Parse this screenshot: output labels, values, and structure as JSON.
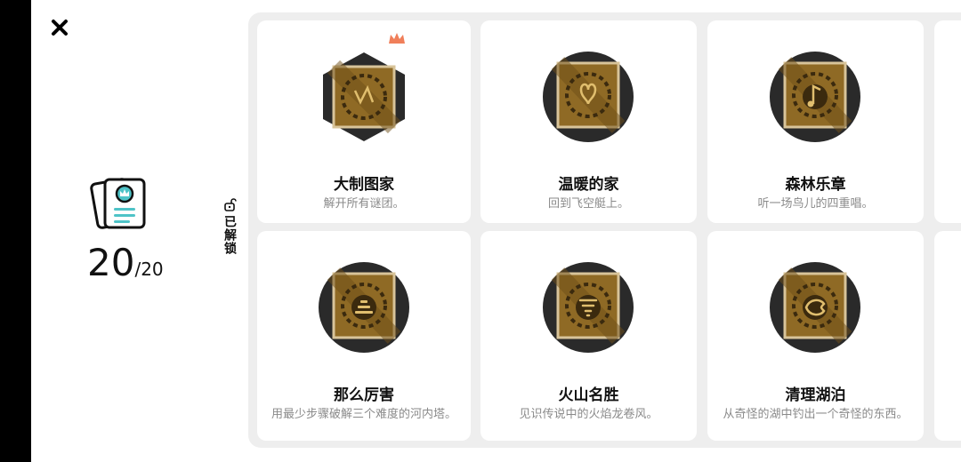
{
  "summary": {
    "unlocked_count": "20",
    "total": "/20",
    "unlock_label": "已解锁"
  },
  "icons": {
    "close": "close-icon",
    "summary": "achievement-book-icon",
    "lock": "unlock-icon"
  },
  "achievements": [
    {
      "title": "大制图家",
      "desc": "解开所有谜团。",
      "shape": "hexagon",
      "glyph": "map"
    },
    {
      "title": "温暖的家",
      "desc": "回到飞空艇上。",
      "shape": "circle",
      "glyph": "home"
    },
    {
      "title": "森林乐章",
      "desc": "听一场鸟儿的四重唱。",
      "shape": "circle",
      "glyph": "note"
    },
    {
      "title": "那么厉害",
      "desc": "用最少步骤破解三个难度的河内塔。",
      "shape": "circle",
      "glyph": "tower"
    },
    {
      "title": "火山名胜",
      "desc": "见识传说中的火焰龙卷风。",
      "shape": "circle",
      "glyph": "tornado"
    },
    {
      "title": "清理湖泊",
      "desc": "从奇怪的湖中钓出一个奇怪的东西。",
      "shape": "circle",
      "glyph": "fish"
    }
  ],
  "colors": {
    "panel_bg": "#eeeeee",
    "badge_dark": "#2a2a2a",
    "badge_gold": "#a77a2b",
    "crown": "#f07f5a",
    "summary_teal": "#4ec3c7"
  }
}
